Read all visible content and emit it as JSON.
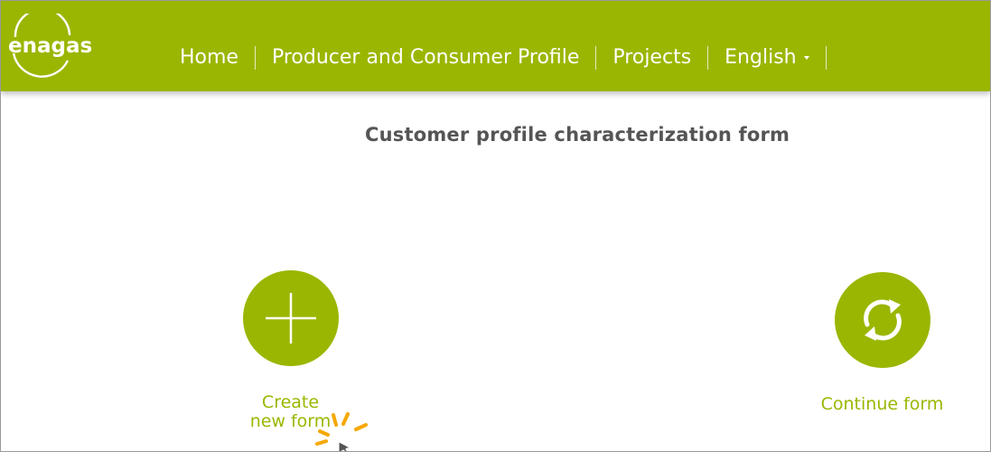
{
  "brand": {
    "logo_text": "enagas",
    "primary_color": "#9bb600"
  },
  "nav": {
    "items": [
      {
        "label": "Home"
      },
      {
        "label": "Producer and Consumer Profile"
      },
      {
        "label": "Projects"
      },
      {
        "label": "English"
      }
    ]
  },
  "page": {
    "title": "Customer profile characterization form"
  },
  "actions": {
    "create": {
      "label": "Create\nnew form",
      "icon": "plus-icon"
    },
    "continue": {
      "label": "Continue form",
      "icon": "refresh-icon"
    }
  },
  "overlay": {
    "cursor_icon": "click-cursor-icon",
    "cursor_sparkle_color": "#f5a800"
  }
}
